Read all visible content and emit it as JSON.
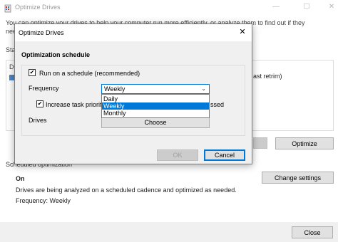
{
  "background_window": {
    "title": "Optimize Drives",
    "intro_text": "You can optimize your drives to help your computer run more efficiently, or analyze them to find out if they need to be optimized.",
    "status_label": "Sta",
    "list_header": "Dr",
    "list_cell": "ast retrim)",
    "optimize_label": "Optimize",
    "scheduled_label": "Scheduled optimization",
    "scheduled_status": "On",
    "scheduled_description": "Drives are being analyzed on a scheduled cadence and optimized as needed.",
    "scheduled_frequency": "Frequency: Weekly",
    "change_settings_label": "Change settings",
    "close_label": "Close"
  },
  "dialog": {
    "title": "Optimize Drives",
    "close_glyph": "✕",
    "section_title": "Optimization schedule",
    "run_on_schedule": {
      "label": "Run on a schedule (recommended)",
      "checked": true
    },
    "frequency_label": "Frequency",
    "frequency_select": {
      "value": "Weekly",
      "options": [
        "Daily",
        "Weekly",
        "Monthly"
      ],
      "highlighted": "Weekly"
    },
    "increase_priority": {
      "label": "Increase task priority,",
      "tail": "ssed",
      "checked": true
    },
    "drives_label": "Drives",
    "choose_label": "Choose",
    "ok_label": "OK",
    "cancel_label": "Cancel"
  },
  "colors": {
    "accent": "#0078d7",
    "dialog_bg": "#f0f0f0",
    "button_bg": "#e1e1e1"
  }
}
